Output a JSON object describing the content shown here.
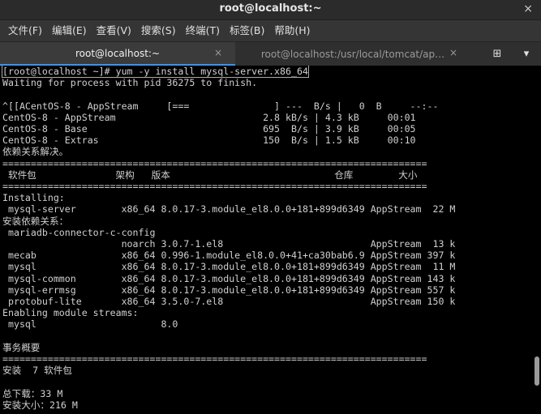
{
  "window": {
    "title": "root@localhost:~",
    "close_glyph": "×"
  },
  "menu": [
    "文件(F)",
    "编辑(E)",
    "查看(V)",
    "搜索(S)",
    "终端(T)",
    "标签(B)",
    "帮助(H)"
  ],
  "tabs": [
    {
      "label": "root@localhost:~",
      "active": true
    },
    {
      "label": "root@localhost:/usr/local/tomcat/ap…",
      "active": false
    }
  ],
  "tab_close_glyph": "×",
  "tab_actions": {
    "new_tab_icon": "⊞",
    "menu_icon": "▾"
  },
  "terminal": {
    "prompt": "[root@localhost ~]# yum -y install mysql-server.x86_64",
    "lines": [
      "Waiting for process with pid 36275 to finish.",
      "",
      "^[[ACentOS-8 - AppStream     [===               ] ---  B/s |   0  B     --:--",
      "CentOS-8 - AppStream                          2.8 kB/s | 4.3 kB     00:01",
      "CentOS-8 - Base                               695  B/s | 3.9 kB     00:05",
      "CentOS-8 - Extras                             150  B/s | 1.5 kB     00:10",
      "依赖关系解决。",
      "===========================================================================",
      " 软件包              架构   版本                             仓库        大小",
      "===========================================================================",
      "Installing:",
      " mysql-server        x86_64 8.0.17-3.module_el8.0.0+181+899d6349 AppStream  22 M",
      "安装依赖关系：",
      " mariadb-connector-c-config",
      "                     noarch 3.0.7-1.el8                          AppStream  13 k",
      " mecab               x86_64 0.996-1.module_el8.0.0+41+ca30bab6.9 AppStream 397 k",
      " mysql               x86_64 8.0.17-3.module_el8.0.0+181+899d6349 AppStream  11 M",
      " mysql-common        x86_64 8.0.17-3.module_el8.0.0+181+899d6349 AppStream 143 k",
      " mysql-errmsg        x86_64 8.0.17-3.module_el8.0.0+181+899d6349 AppStream 557 k",
      " protobuf-lite       x86_64 3.5.0-7.el8                          AppStream 150 k",
      "Enabling module streams:",
      " mysql                      8.0",
      "",
      "事务概要",
      "===========================================================================",
      "安装  7 软件包",
      "",
      "总下载：33 M",
      "安装大小：216 M"
    ]
  },
  "scrollbar": {
    "position": 0.92
  }
}
